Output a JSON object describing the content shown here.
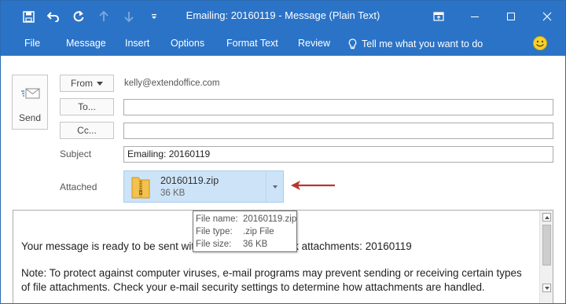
{
  "window": {
    "title": "Emailing: 20160119 - Message (Plain Text)",
    "accent_color": "#2b73c7"
  },
  "quick_access": [
    "save-icon",
    "undo-icon",
    "redo-icon",
    "up-arrow-icon",
    "down-arrow-icon",
    "customize-dropdown-icon"
  ],
  "ribbon": {
    "tabs": [
      "File",
      "Message",
      "Insert",
      "Options",
      "Format Text",
      "Review"
    ],
    "tell_me": "Tell me what you want to do"
  },
  "compose": {
    "send_label": "Send",
    "from_label": "From",
    "from_address": "kelly@extendoffice.com",
    "to_label": "To...",
    "cc_label": "Cc...",
    "to_value": "",
    "cc_value": "",
    "subject_label": "Subject",
    "subject_value": "Emailing: 20160119",
    "attached_label": "Attached"
  },
  "attachment": {
    "name": "20160119.zip",
    "size": "36 KB"
  },
  "tooltip": {
    "file_name_label": "File name:",
    "file_name": "20160119.zip",
    "file_type_label": "File type:",
    "file_type": ".zip File",
    "file_size_label": "File size:",
    "file_size": "36 KB"
  },
  "body": {
    "line1": "Your message is ready to be sent wit                              link attachments: 20160119",
    "line2": "Note: To protect against computer viruses, e-mail programs may prevent sending or receiving certain types",
    "line3": "of file attachments.  Check your e-mail security settings to determine how attachments are handled."
  }
}
